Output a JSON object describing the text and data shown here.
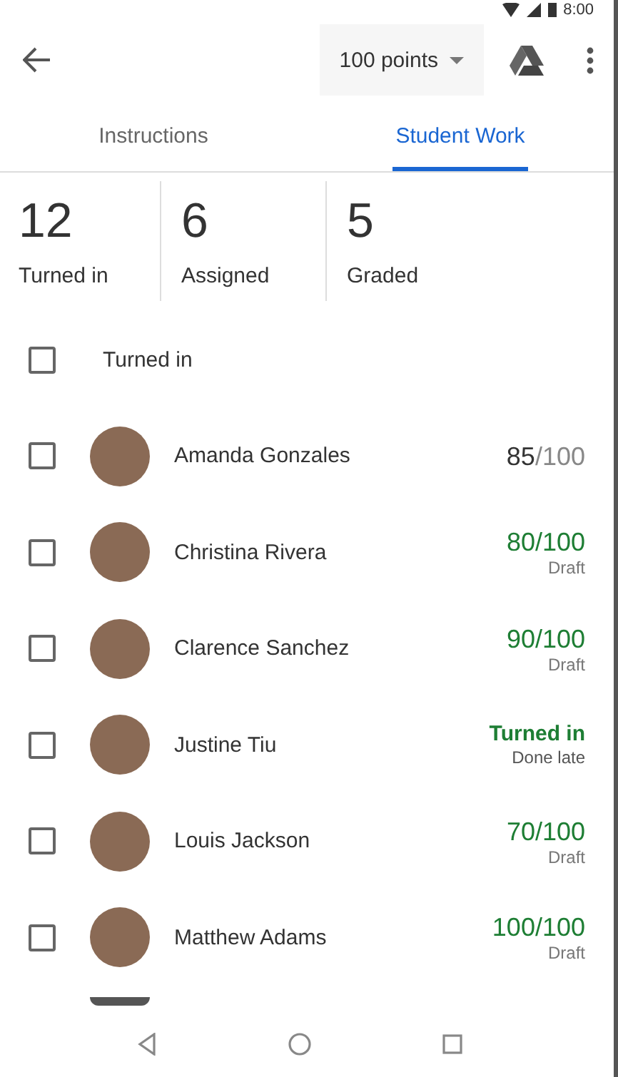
{
  "status_bar": {
    "time": "8:00"
  },
  "app_bar": {
    "points": "100 points"
  },
  "tabs": [
    {
      "label": "Instructions",
      "selected": false
    },
    {
      "label": "Student Work",
      "selected": true
    }
  ],
  "stats": [
    {
      "count": "12",
      "label": "Turned in"
    },
    {
      "count": "6",
      "label": "Assigned"
    },
    {
      "count": "5",
      "label": "Graded"
    }
  ],
  "section": {
    "label": "Turned in",
    "checked": false
  },
  "students": [
    {
      "name": "Amanda Gonzales",
      "checked": false,
      "grade": {
        "kind": "returned",
        "score": "85",
        "total": "/100"
      }
    },
    {
      "name": "Christina Rivera",
      "checked": false,
      "grade": {
        "kind": "draft",
        "text": "80/100",
        "note": "Draft"
      }
    },
    {
      "name": "Clarence Sanchez",
      "checked": false,
      "grade": {
        "kind": "draft",
        "text": "90/100",
        "note": "Draft"
      }
    },
    {
      "name": "Justine Tiu",
      "checked": false,
      "grade": {
        "kind": "turned_in",
        "text": "Turned in",
        "note": "Done late"
      }
    },
    {
      "name": "Louis Jackson",
      "checked": false,
      "grade": {
        "kind": "draft",
        "text": "70/100",
        "note": "Draft"
      }
    },
    {
      "name": "Matthew Adams",
      "checked": false,
      "grade": {
        "kind": "draft",
        "text": "100/100",
        "note": "Draft"
      }
    }
  ]
}
